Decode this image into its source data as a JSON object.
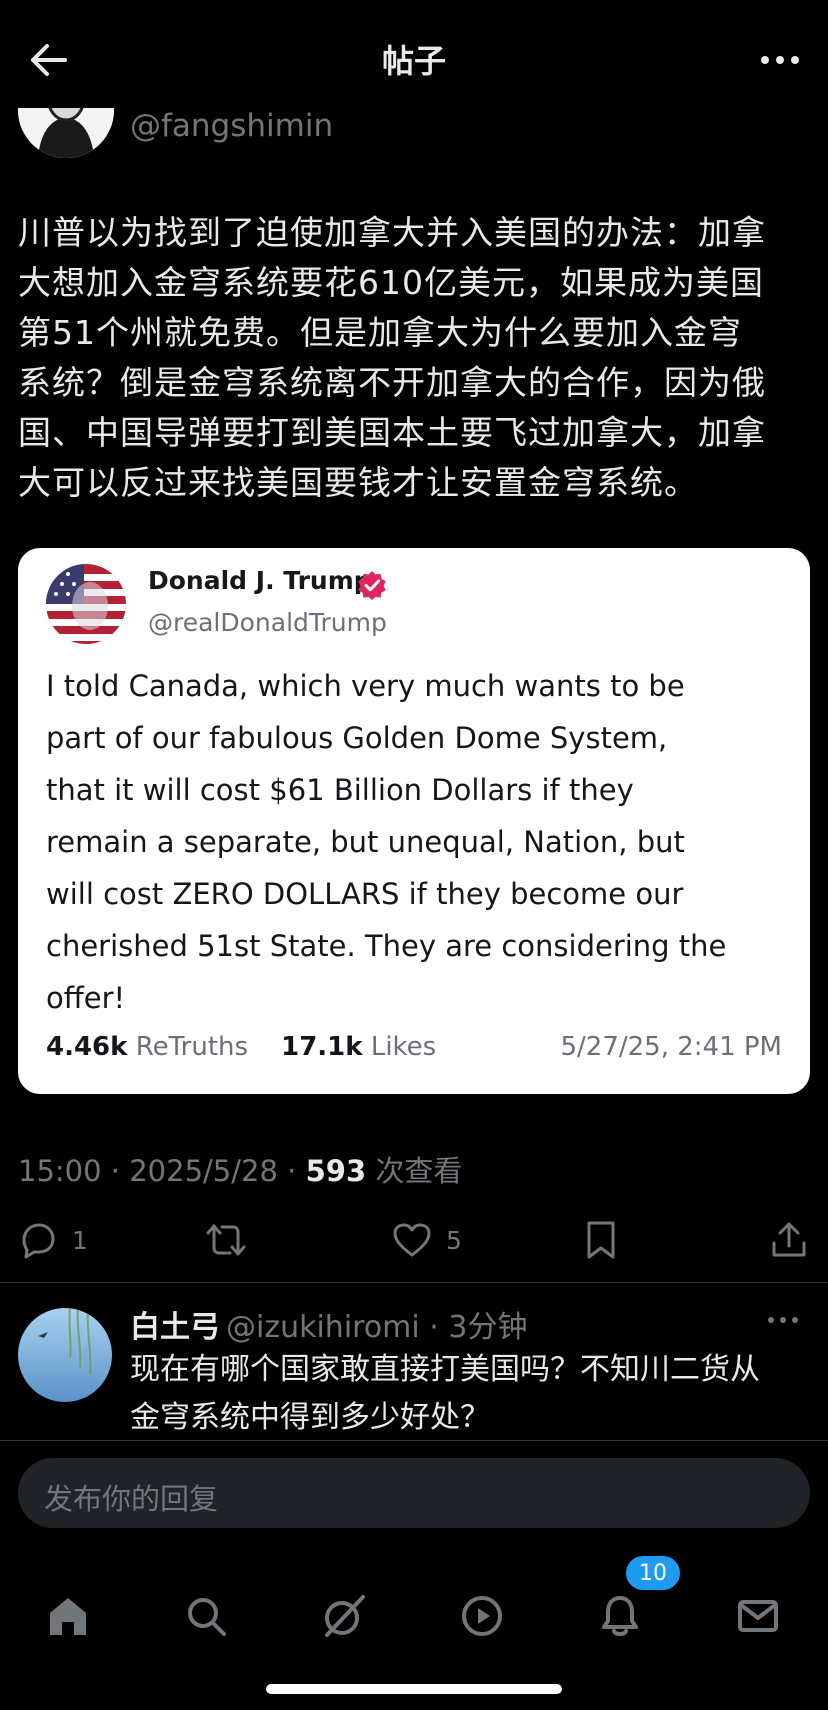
{
  "header": {
    "title": "帖子"
  },
  "post": {
    "handle": "@fangshimin",
    "text": "川普以为找到了迫使加拿大并入美国的办法：加拿\n大想加入金穹系统要花610亿美元，如果成为美国\n第51个州就免费。但是加拿大为什么要加入金穹\n系统？倒是金穹系统离不开加拿大的合作，因为俄\n国、中国导弹要打到美国本土要飞过加拿大，加拿\n大可以反过来找美国要钱才让安置金穹系统。",
    "time": "15:00 · 2025/5/28 · ",
    "views_count": "593",
    "views_label": "次查看"
  },
  "quote": {
    "name": "Donald J. Trump",
    "handle": "@realDonaldTrump",
    "body": "I told Canada, which very much wants to be\npart of our fabulous Golden Dome System,\nthat it will cost $61 Billion Dollars if they\nremain a separate, but unequal, Nation, but\nwill cost ZERO DOLLARS if they become our\ncherished 51st State. They are considering the\noffer!",
    "retruths_count": "4.46k",
    "retruths_label": "ReTruths",
    "likes_count": "17.1k",
    "likes_label": "Likes",
    "date": "5/27/25, 2:41 PM",
    "verified_color": "#e0245e"
  },
  "actions": {
    "replies": "1",
    "likes": "5"
  },
  "reply": {
    "name": "白土弓",
    "handle": "@izukihiromi",
    "time": "· 3分钟",
    "text": "现在有哪个国家敢直接打美国吗？不知川二货从\n金穹系统中得到多少好处？"
  },
  "composer": {
    "placeholder": "发布你的回复"
  },
  "tabs": {
    "notifications_badge": "10",
    "items": [
      "home-icon",
      "search-icon",
      "grok-icon",
      "video-icon",
      "bell-icon",
      "mail-icon"
    ]
  },
  "colors": {
    "background": "#000000",
    "accent": "#1d9bf0",
    "muted": "#71767b"
  }
}
